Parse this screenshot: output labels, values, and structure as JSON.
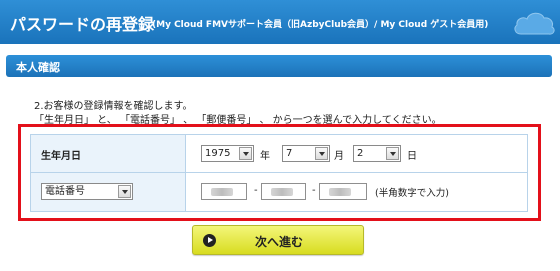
{
  "header": {
    "title": "パスワードの再登録",
    "subtitle": "(My Cloud FMVサポート会員（旧AzbyClub会員）/ My Cloud ゲスト会員用)"
  },
  "section": {
    "title": "本人確認"
  },
  "instructions": {
    "line1": "2.お客様の登録情報を確認します。",
    "line2": "「生年月日」 と、 「電話番号」 、 「郵便番号」 、 から一つを選んで入力してください。"
  },
  "birthdate": {
    "label": "生年月日",
    "year": "1975",
    "year_unit": "年",
    "month": "7",
    "month_unit": "月",
    "day": "2",
    "day_unit": "日"
  },
  "contact": {
    "type_selected": "電話番号",
    "separator": "-",
    "hint": "(半角数字で入力)"
  },
  "next_button": {
    "label": "次へ進む"
  },
  "colors": {
    "header_blue": "#1a73bb",
    "highlight_red": "#e3101a",
    "button_yellow": "#d8dc20",
    "label_bg": "#eaf3fb"
  }
}
